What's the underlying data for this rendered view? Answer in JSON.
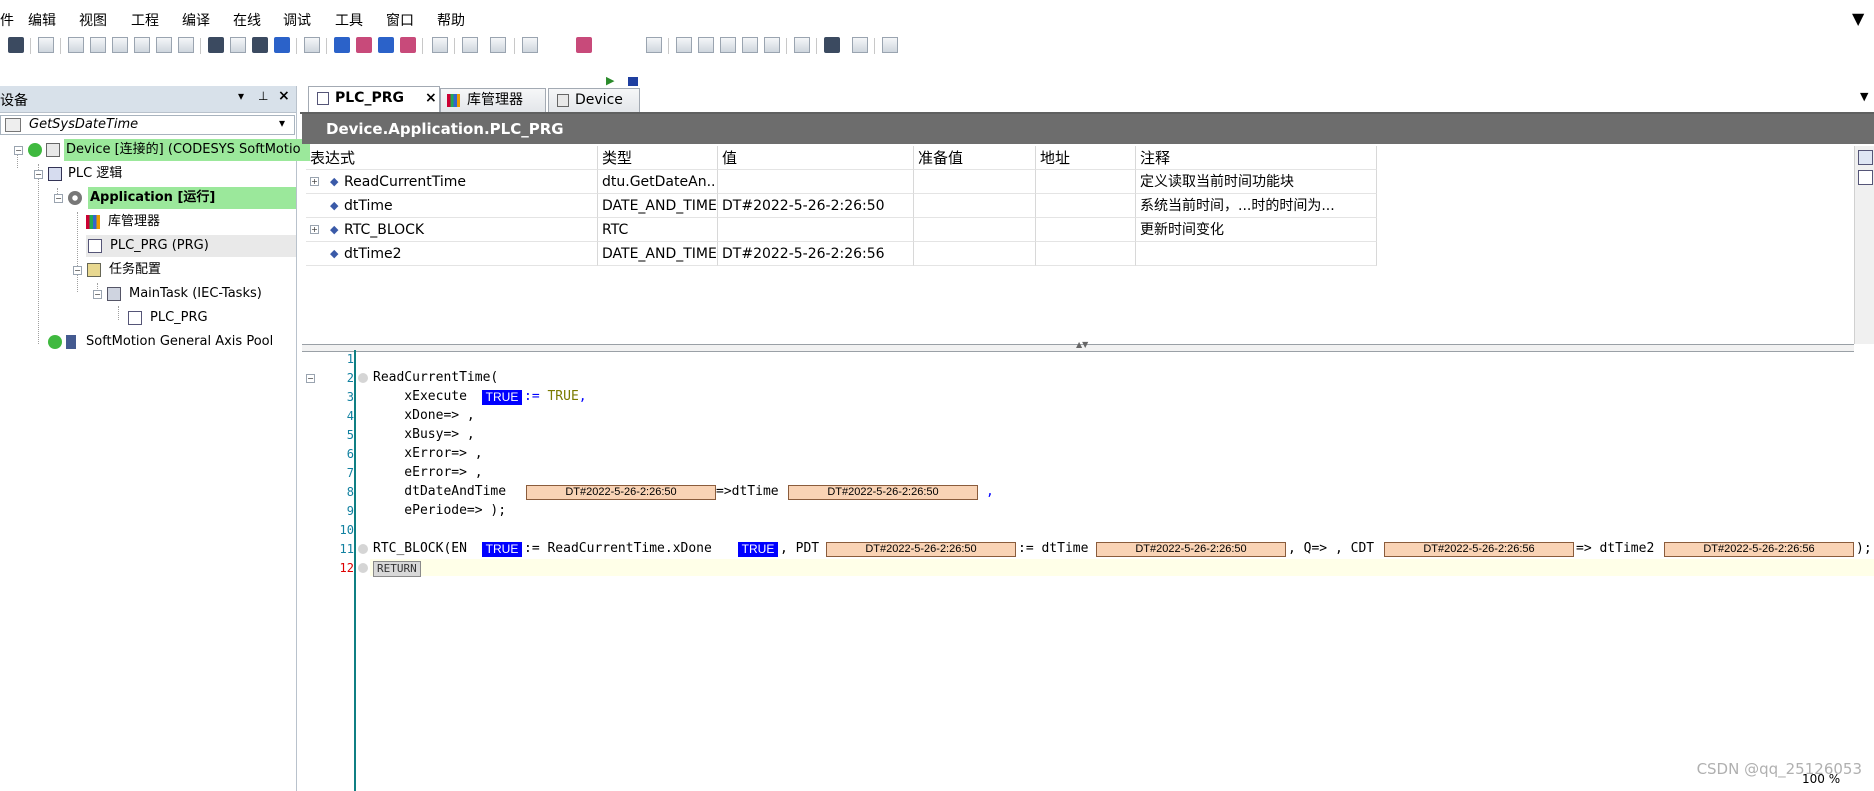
{
  "menu": [
    "件",
    "编辑",
    "视图",
    "工程",
    "编译",
    "在线",
    "调试",
    "工具",
    "窗口",
    "帮助"
  ],
  "left_panel": {
    "title": "设备",
    "project": "GetSysDateTime",
    "tree": [
      {
        "label": "Device [连接的] (CODESYS SoftMotio",
        "state": "connected"
      },
      {
        "label": "PLC 逻辑"
      },
      {
        "label": "Application [运行]",
        "state": "running"
      },
      {
        "label": "库管理器"
      },
      {
        "label": "PLC_PRG (PRG)",
        "state": "selected"
      },
      {
        "label": "任务配置"
      },
      {
        "label": "MainTask (IEC-Tasks)"
      },
      {
        "label": "PLC_PRG"
      },
      {
        "label": "SoftMotion General Axis Pool"
      }
    ]
  },
  "tabs": [
    {
      "label": "PLC_PRG",
      "active": true
    },
    {
      "label": "库管理器",
      "active": false
    },
    {
      "label": "Device",
      "active": false
    }
  ],
  "path": "Device.Application.PLC_PRG",
  "table": {
    "columns": [
      "表达式",
      "类型",
      "值",
      "准备值",
      "地址",
      "注释"
    ],
    "rows": [
      {
        "expr": "ReadCurrentTime",
        "type": "dtu.GetDateAn...",
        "value": "",
        "prepared": "",
        "address": "",
        "comment": "定义读取当前时间功能块",
        "expandable": true
      },
      {
        "expr": "dtTime",
        "type": "DATE_AND_TIME",
        "value": "DT#2022-5-26-2:26:50",
        "prepared": "",
        "address": "",
        "comment": "系统当前时间，...时的时间为...",
        "expandable": false
      },
      {
        "expr": "RTC_BLOCK",
        "type": "RTC",
        "value": "",
        "prepared": "",
        "address": "",
        "comment": "更新时间变化",
        "expandable": true
      },
      {
        "expr": "dtTime2",
        "type": "DATE_AND_TIME",
        "value": "DT#2022-5-26-2:26:56",
        "prepared": "",
        "address": "",
        "comment": "",
        "expandable": false
      }
    ]
  },
  "code": {
    "line_numbers": [
      "1",
      "2",
      "3",
      "4",
      "5",
      "6",
      "7",
      "8",
      "9",
      "10",
      "11",
      "12"
    ],
    "l2": "ReadCurrentTime(",
    "l3a": "    xExecute",
    "l3b": ":= ",
    "l3c": "TRUE",
    "l3d": ",",
    "l4": "    xDone=> ,",
    "l5": "    xBusy=> ,",
    "l6": "    xError=> ,",
    "l7": "    eError=> ,",
    "l8a": "    dtDateAndTime",
    "l8b": "=>dtTime",
    "l8c": ",",
    "l9": "    ePeriode=> );",
    "l11a": "RTC_BLOCK(EN",
    "l11b": ":= ReadCurrentTime.xDone",
    "l11c": ", PDT",
    "l11d": ":= dtTime",
    "l11e": ", Q=> , CDT",
    "l11f": "=> dtTime2",
    "l11g": ");",
    "return": "RETURN",
    "mon_true": "TRUE",
    "mon_dt1": "DT#2022-5-26-2:26:50",
    "mon_dt2": "DT#2022-5-26-2:26:56"
  },
  "status": {
    "zoom": "100 %"
  },
  "watermark": "CSDN @qq_25126053"
}
